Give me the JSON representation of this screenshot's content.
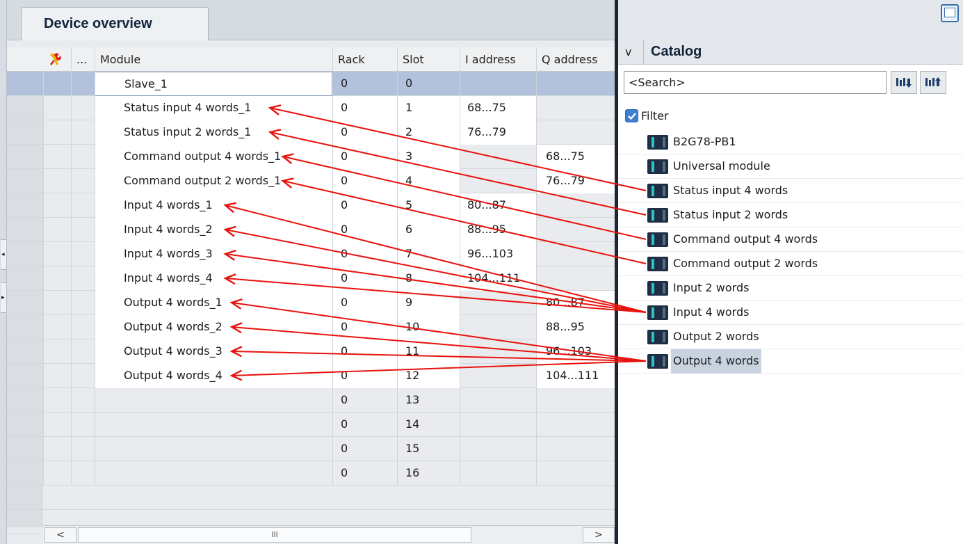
{
  "device_overview": {
    "tab_label": "Device overview",
    "columns": {
      "ellipsis": "...",
      "module": "Module",
      "rack": "Rack",
      "slot": "Slot",
      "i_address": "I address",
      "q_address": "Q address"
    },
    "rows": [
      {
        "module": "Slave_1",
        "rack": "0",
        "slot": "0",
        "i_address": "",
        "q_address": ""
      },
      {
        "module": "Status input 4 words_1",
        "rack": "0",
        "slot": "1",
        "i_address": "68...75",
        "q_address": ""
      },
      {
        "module": "Status input 2 words_1",
        "rack": "0",
        "slot": "2",
        "i_address": "76...79",
        "q_address": ""
      },
      {
        "module": "Command output 4 words_1",
        "rack": "0",
        "slot": "3",
        "i_address": "",
        "q_address": "68...75"
      },
      {
        "module": "Command output 2 words_1",
        "rack": "0",
        "slot": "4",
        "i_address": "",
        "q_address": "76...79"
      },
      {
        "module": "Input 4 words_1",
        "rack": "0",
        "slot": "5",
        "i_address": "80...87",
        "q_address": ""
      },
      {
        "module": "Input 4 words_2",
        "rack": "0",
        "slot": "6",
        "i_address": "88...95",
        "q_address": ""
      },
      {
        "module": "Input 4 words_3",
        "rack": "0",
        "slot": "7",
        "i_address": "96...103",
        "q_address": ""
      },
      {
        "module": "Input 4 words_4",
        "rack": "0",
        "slot": "8",
        "i_address": "104...111",
        "q_address": ""
      },
      {
        "module": "Output 4 words_1",
        "rack": "0",
        "slot": "9",
        "i_address": "",
        "q_address": "80...87"
      },
      {
        "module": "Output 4 words_2",
        "rack": "0",
        "slot": "10",
        "i_address": "",
        "q_address": "88...95"
      },
      {
        "module": "Output 4 words_3",
        "rack": "0",
        "slot": "11",
        "i_address": "",
        "q_address": "96...103"
      },
      {
        "module": "Output 4 words_4",
        "rack": "0",
        "slot": "12",
        "i_address": "",
        "q_address": "104...111"
      },
      {
        "module": "",
        "rack": "0",
        "slot": "13",
        "i_address": "",
        "q_address": ""
      },
      {
        "module": "",
        "rack": "0",
        "slot": "14",
        "i_address": "",
        "q_address": ""
      },
      {
        "module": "",
        "rack": "0",
        "slot": "15",
        "i_address": "",
        "q_address": ""
      },
      {
        "module": "",
        "rack": "0",
        "slot": "16",
        "i_address": "",
        "q_address": ""
      }
    ],
    "scrollbar": {
      "left_arrow": "<",
      "thumb_grip": "III",
      "right_arrow": ">"
    },
    "side_arrows": {
      "collapse": "◂",
      "expand": "▸"
    }
  },
  "catalog": {
    "chevron": "v",
    "title": "Catalog",
    "search_value": "<Search>",
    "filter_label": "Filter",
    "filter_checked": true,
    "items": [
      {
        "label": "B2G78-PB1"
      },
      {
        "label": "Universal module"
      },
      {
        "label": "Status input 4 words"
      },
      {
        "label": "Status input 2 words"
      },
      {
        "label": "Command output 4 words"
      },
      {
        "label": "Command output 2 words"
      },
      {
        "label": "Input 2 words"
      },
      {
        "label": "Input 4 words"
      },
      {
        "label": "Output 2 words"
      },
      {
        "label": "Output 4 words",
        "highlighted": true
      }
    ]
  },
  "annotation": {
    "arrow_color": "#e8120c",
    "links": [
      {
        "catalog_item": "Status input 4 words",
        "module": "Status input 4 words_1"
      },
      {
        "catalog_item": "Status input 2 words",
        "module": "Status input 2 words_1"
      },
      {
        "catalog_item": "Command output 4 words",
        "module": "Command output 4 words_1"
      },
      {
        "catalog_item": "Command output 2 words",
        "module": "Command output 2 words_1"
      },
      {
        "catalog_item": "Input 4 words",
        "module": "Input 4 words_1"
      },
      {
        "catalog_item": "Input 4 words",
        "module": "Input 4 words_2"
      },
      {
        "catalog_item": "Input 4 words",
        "module": "Input 4 words_3"
      },
      {
        "catalog_item": "Input 4 words",
        "module": "Input 4 words_4"
      },
      {
        "catalog_item": "Output 4 words",
        "module": "Output 4 words_1"
      },
      {
        "catalog_item": "Output 4 words",
        "module": "Output 4 words_2"
      },
      {
        "catalog_item": "Output 4 words",
        "module": "Output 4 words_3"
      },
      {
        "catalog_item": "Output 4 words",
        "module": "Output 4 words_4"
      }
    ]
  }
}
